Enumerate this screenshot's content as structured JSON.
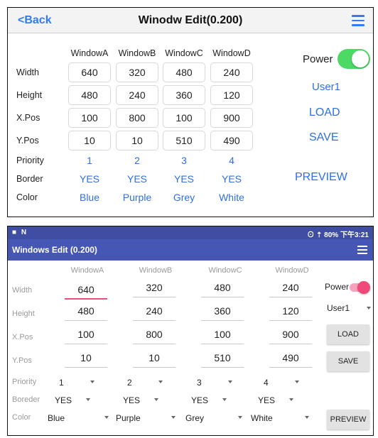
{
  "ios": {
    "back_label": "<Back",
    "title": "Winodw Edit(0.200)",
    "columns": [
      "WindowA",
      "WindowB",
      "WindowC",
      "WindowD"
    ],
    "row_labels": {
      "width": "Width",
      "height": "Height",
      "xpos": "X.Pos",
      "ypos": "Y.Pos",
      "priority": "Priority",
      "border": "Border",
      "color": "Color"
    },
    "values": {
      "width": [
        "640",
        "320",
        "480",
        "240"
      ],
      "height": [
        "480",
        "240",
        "360",
        "120"
      ],
      "xpos": [
        "100",
        "800",
        "100",
        "900"
      ],
      "ypos": [
        "10",
        "10",
        "510",
        "490"
      ],
      "priority": [
        "1",
        "2",
        "3",
        "4"
      ],
      "border": [
        "YES",
        "YES",
        "YES",
        "YES"
      ],
      "color": [
        "Blue",
        "Purple",
        "Grey",
        "White"
      ]
    },
    "power_label": "Power",
    "power_on": true,
    "user": "User1",
    "load_label": "LOAD",
    "save_label": "SAVE",
    "preview_label": "PREVIEW",
    "accent_color": "#2f6fe0",
    "toggle_color": "#4cd964"
  },
  "android": {
    "status_left": "■ N",
    "status_right": "⊙ ⇡ 80% 下午3:21",
    "title": "Windows Edit (0.200)",
    "columns": [
      "WindowA",
      "WindowB",
      "WindowC",
      "WindowD"
    ],
    "row_labels": {
      "width": "Width",
      "height": "Height",
      "xpos": "X.Pos",
      "ypos": "Y.Pos",
      "priority": "Priority",
      "border": "Boreder",
      "color": "Color"
    },
    "values": {
      "width": [
        "640",
        "320",
        "480",
        "240"
      ],
      "height": [
        "480",
        "240",
        "360",
        "120"
      ],
      "xpos": [
        "100",
        "800",
        "100",
        "900"
      ],
      "ypos": [
        "10",
        "10",
        "510",
        "490"
      ],
      "priority": [
        "1",
        "2",
        "3",
        "4"
      ],
      "border": [
        "YES",
        "YES",
        "YES",
        "YES"
      ],
      "color": [
        "Blue",
        "Purple",
        "Grey",
        "White"
      ]
    },
    "power_label": "Power",
    "power_on": true,
    "user": "User1",
    "load_label": "LOAD",
    "save_label": "SAVE",
    "preview_label": "PREVIEW",
    "appbar_color": "#4556b5",
    "accent_color": "#f04a7a"
  }
}
